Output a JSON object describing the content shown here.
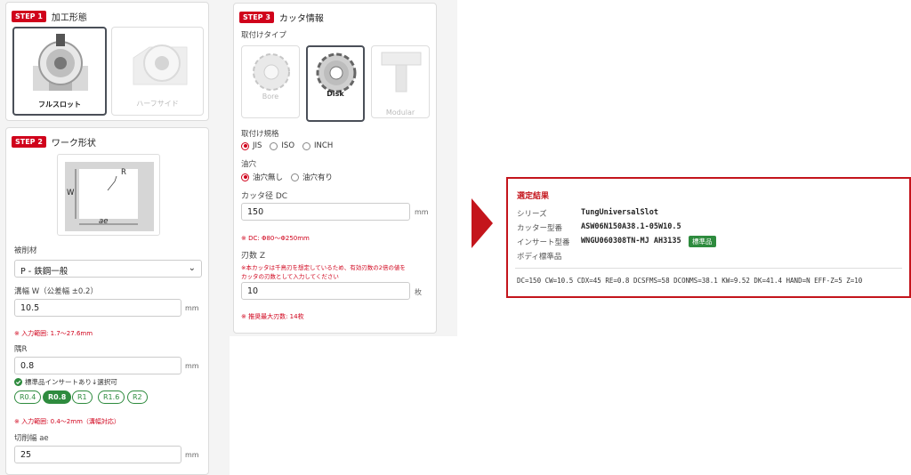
{
  "step1": {
    "badge": "STEP 1",
    "title": "加工形態",
    "options": [
      {
        "label": "フルスロット",
        "selected": true
      },
      {
        "label": "ハーフサイド",
        "selected": false
      }
    ]
  },
  "step2": {
    "badge": "STEP 2",
    "title": "ワーク形状",
    "diagram": {
      "w_label": "W",
      "r_label": "R",
      "ae_label": "ae"
    },
    "material": {
      "label": "被削材",
      "value": "P - 鉄鋼一般"
    },
    "slot_width": {
      "label": "溝幅 W（公差幅 ±0.2）",
      "value": "10.5",
      "unit": "mm",
      "note": "※ 入力範囲: 1.7〜27.6mm"
    },
    "corner_r": {
      "label": "隅R",
      "value": "0.8",
      "unit": "mm",
      "std_note": "標準品インサートあり↓選択可",
      "options": [
        {
          "label": "R0.4",
          "selected": false
        },
        {
          "label": "R0.8",
          "selected": true
        },
        {
          "label": "R1",
          "selected": false
        },
        {
          "label": "R1.6",
          "selected": false
        },
        {
          "label": "R2",
          "selected": false
        }
      ],
      "note": "※ 入力範囲: 0.4〜2mm（溝幅対応）"
    },
    "cut_width": {
      "label": "切削幅 ae",
      "value": "25",
      "unit": "mm"
    }
  },
  "step3": {
    "badge": "STEP 3",
    "title": "カッタ情報",
    "mount_type": {
      "label": "取付けタイプ",
      "options": [
        {
          "label": "Bore",
          "selected": false
        },
        {
          "label": "Disk",
          "selected": true
        },
        {
          "label": "Modular",
          "selected": false
        }
      ]
    },
    "mount_std": {
      "label": "取付け規格",
      "options": [
        {
          "label": "JIS",
          "selected": true
        },
        {
          "label": "ISO",
          "selected": false
        },
        {
          "label": "INCH",
          "selected": false
        }
      ]
    },
    "oil_hole": {
      "label": "油穴",
      "options": [
        {
          "label": "油穴無し",
          "selected": true
        },
        {
          "label": "油穴有り",
          "selected": false
        }
      ]
    },
    "cutter_dia": {
      "label": "カッタ径 DC",
      "value": "150",
      "unit": "mm",
      "note": "※ DC: Φ80〜Φ250mm"
    },
    "teeth": {
      "label": "刃数 Z",
      "warning_line1": "※本カッタは千鳥刃を想定しているため、有効刃数の2倍の値を",
      "warning_line2": "カッタの刃数として入力してください",
      "value": "10",
      "unit": "枚",
      "note": "※ 推奨最大刃数: 14枚"
    }
  },
  "result": {
    "title": "選定結果",
    "rows": [
      {
        "key": "シリーズ",
        "value": "TungUniversalSlot"
      },
      {
        "key": "カッター型番",
        "value": "ASW06N150A38.1-05W10.5"
      },
      {
        "key": "インサート型番",
        "value": "WNGU060308TN-MJ AH3135"
      },
      {
        "key": "ボディ標準品",
        "value": ""
      }
    ],
    "std_badge": "標準品",
    "specs": "DC=150 CW=10.5 CDX=45 RE=0.8 DCSFMS=58 DCONMS=38.1 KW=9.52 DK=41.4 HAND=N EFF-Z=5 Z=10"
  },
  "colors": {
    "accent": "#c4151c",
    "green": "#2e8b3e"
  }
}
